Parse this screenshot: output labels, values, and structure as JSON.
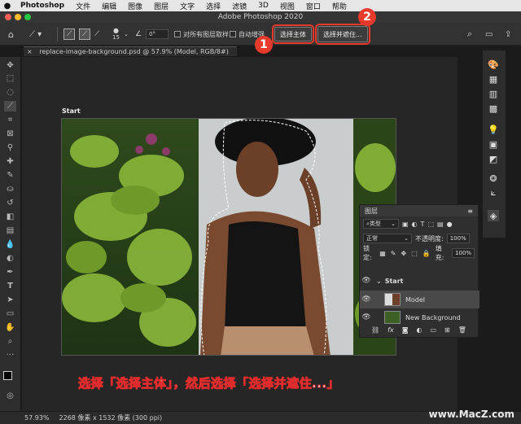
{
  "menubar": {
    "app": "Photoshop",
    "items": [
      "文件",
      "编辑",
      "图像",
      "图层",
      "文字",
      "选择",
      "滤镜",
      "3D",
      "视图",
      "窗口",
      "帮助"
    ]
  },
  "window": {
    "title": "Adobe Photoshop 2020"
  },
  "options_bar": {
    "brush_size": "15",
    "angle": "0°",
    "sample_all_label": "对所有图层取样",
    "auto_enhance_label": "自动增强",
    "select_subject_label": "选择主体",
    "select_mask_label": "选择并遮住...",
    "step1": "1",
    "step2": "2"
  },
  "document_tab": {
    "label": "replace-image-background.psd @ 57.9% (Model, RGB/8#)"
  },
  "artboard": {
    "label": "Start"
  },
  "layers_panel": {
    "title": "图层",
    "filter_label": "类型",
    "blend_mode": "正常",
    "opacity_label": "不透明度:",
    "opacity_value": "100%",
    "lock_label": "锁定:",
    "fill_label": "填充:",
    "fill_value": "100%",
    "group_name": "Start",
    "layers": [
      {
        "name": "Model"
      },
      {
        "name": "New Background"
      }
    ],
    "footer_fx": "fx"
  },
  "status": {
    "zoom": "57.93%",
    "info": "2268 像素 x 1532 像素 (300 ppi)"
  },
  "caption": "选择「选择主体」，然后选择「选择并遮住...」",
  "watermark": "www.MacZ.com",
  "colors": {
    "accent_red": "#e63a2c",
    "panel": "#2f2f2f"
  }
}
